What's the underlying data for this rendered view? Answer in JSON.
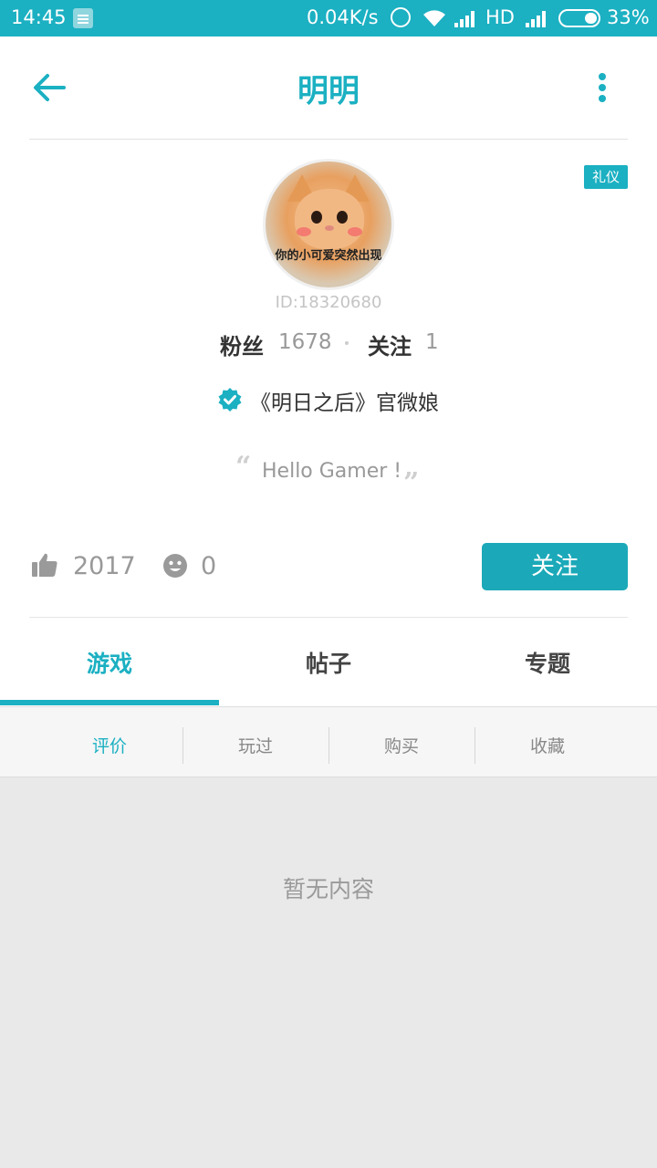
{
  "status_bar": {
    "time": "14:45",
    "net_speed": "0.04K/s",
    "network_type": "HD",
    "battery_pct": "33%",
    "icons": [
      "notification-icon",
      "alarm-icon",
      "wifi-icon",
      "signal-icon",
      "battery-icon"
    ]
  },
  "header": {
    "title": "明明",
    "back_icon": "arrow-left-icon",
    "more_icon": "more-vertical-icon"
  },
  "profile": {
    "tag": "礼仪",
    "avatar_caption": "你的小可爱突然出现",
    "user_id": "ID:18320680",
    "fans_label": "粉丝",
    "fans_count": "1678",
    "following_label": "关注",
    "following_count": "1",
    "verified_text": "《明日之后》官微娘",
    "signature": "Hello Gamer !",
    "likes": "2017",
    "smiles": "0",
    "follow_button": "关注"
  },
  "tabs": [
    {
      "label": "游戏",
      "active": true
    },
    {
      "label": "帖子",
      "active": false
    },
    {
      "label": "专题",
      "active": false
    }
  ],
  "subtabs": [
    {
      "label": "评价",
      "active": true
    },
    {
      "label": "玩过",
      "active": false
    },
    {
      "label": "购买",
      "active": false
    },
    {
      "label": "收藏",
      "active": false
    }
  ],
  "empty_text": "暂无内容",
  "colors": {
    "accent": "#1bb0c2",
    "button": "#1ba9b9",
    "muted_text": "#999999",
    "background": "#e9e9e9"
  }
}
